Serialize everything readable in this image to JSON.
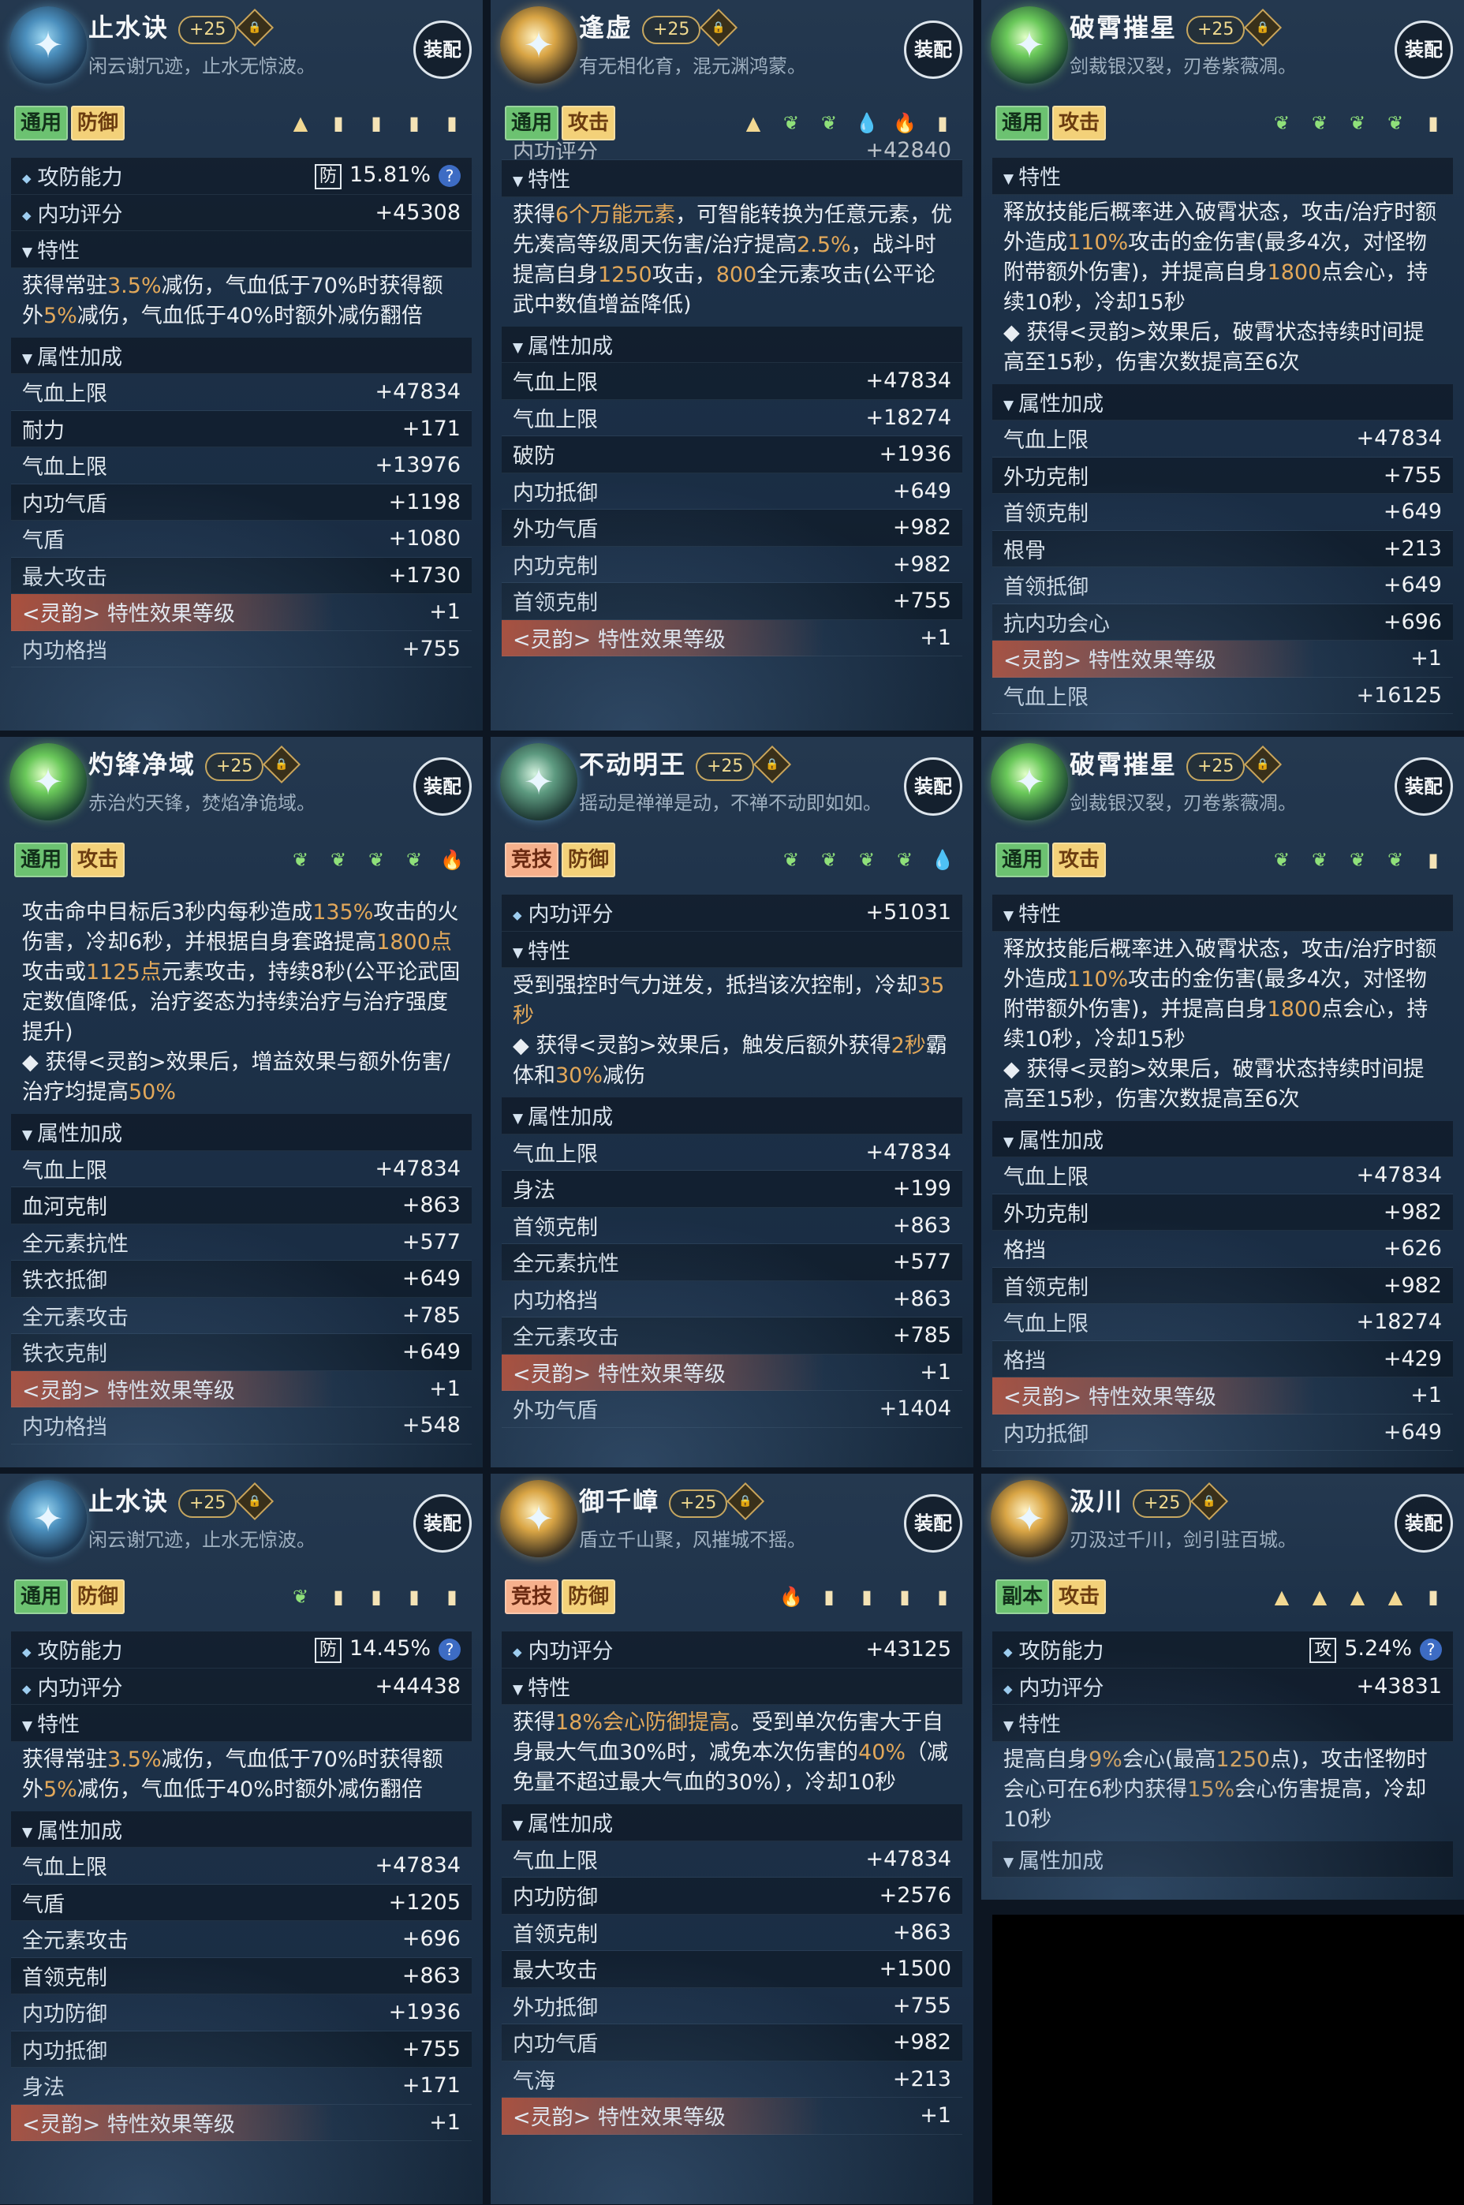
{
  "ui": {
    "equip_label": "装配"
  },
  "cards": [
    {
      "name": "止水诀",
      "level": "+25",
      "desc": "闲云谢冗迹，止水无惊波。",
      "tags": [
        {
          "text": "通用",
          "c": "g"
        },
        {
          "text": "防御",
          "c": "y"
        }
      ],
      "gems": [
        "tri",
        "block",
        "block",
        "block",
        "block"
      ],
      "rows": [
        {
          "t": "bul",
          "l": "攻防能力",
          "box": "防",
          "r": "15.81%",
          "q": true
        },
        {
          "t": "bul",
          "l": "内功评分",
          "r": "+45308"
        },
        {
          "t": "arr",
          "l": "特性"
        },
        {
          "t": "text",
          "parts": [
            [
              "获得常驻",
              ""
            ],
            [
              "3.5%",
              "h"
            ],
            [
              "减伤，气血低于70%时获得额外",
              ""
            ],
            [
              "5%",
              "h"
            ],
            [
              "减伤，气血低于40%时额外减伤翻倍",
              ""
            ]
          ]
        },
        {
          "t": "arr",
          "l": "属性加成"
        },
        {
          "t": "stat",
          "l": "气血上限",
          "r": "+47834"
        },
        {
          "t": "stat",
          "l": "耐力",
          "r": "+171"
        },
        {
          "t": "stat",
          "l": "气血上限",
          "r": "+13976"
        },
        {
          "t": "stat",
          "l": "内功气盾",
          "r": "+1198"
        },
        {
          "t": "stat",
          "l": "气盾",
          "r": "+1080"
        },
        {
          "t": "stat",
          "l": "最大攻击",
          "r": "+1730"
        },
        {
          "t": "ling",
          "l": "<灵韵> 特性效果等级",
          "r": "+1"
        },
        {
          "t": "stat",
          "l": "内功格挡",
          "r": "+755"
        }
      ]
    },
    {
      "name": "逢虚",
      "level": "+25",
      "desc": "有无相化育，混元渊鸿蒙。",
      "tags": [
        {
          "text": "通用",
          "c": "g"
        },
        {
          "text": "攻击",
          "c": "y"
        }
      ],
      "gems": [
        "tri",
        "leaf",
        "leaf",
        "drop",
        "fire",
        "block"
      ],
      "rows": [
        {
          "t": "stat",
          "l": "内功评分",
          "r": "+42840",
          "cut": true
        },
        {
          "t": "arr",
          "l": "特性"
        },
        {
          "t": "text",
          "parts": [
            [
              "获得",
              ""
            ],
            [
              "6个万能元素",
              "h"
            ],
            [
              "，可智能转换为任意元素，优先凑高等级周天伤害/治疗提高",
              ""
            ],
            [
              "2.5%",
              "h"
            ],
            [
              "，战斗时提高自身",
              ""
            ],
            [
              "1250",
              "h"
            ],
            [
              "攻击，",
              ""
            ],
            [
              "800",
              "h"
            ],
            [
              "全元素攻击(公平论武中数值增益降低)",
              ""
            ]
          ]
        },
        {
          "t": "arr",
          "l": "属性加成"
        },
        {
          "t": "stat",
          "l": "气血上限",
          "r": "+47834"
        },
        {
          "t": "stat",
          "l": "气血上限",
          "r": "+18274"
        },
        {
          "t": "stat",
          "l": "破防",
          "r": "+1936"
        },
        {
          "t": "stat",
          "l": "内功抵御",
          "r": "+649"
        },
        {
          "t": "stat",
          "l": "外功气盾",
          "r": "+982"
        },
        {
          "t": "stat",
          "l": "内功克制",
          "r": "+982"
        },
        {
          "t": "stat",
          "l": "首领克制",
          "r": "+755"
        },
        {
          "t": "ling",
          "l": "<灵韵> 特性效果等级",
          "r": "+1"
        }
      ]
    },
    {
      "name": "破霄摧星",
      "level": "+25",
      "desc": "剑裁银汉裂，刃卷紫薇凋。",
      "tags": [
        {
          "text": "通用",
          "c": "g"
        },
        {
          "text": "攻击",
          "c": "y"
        }
      ],
      "gems": [
        "leaf",
        "leaf",
        "leaf",
        "leaf",
        "block"
      ],
      "rows": [
        {
          "t": "arr",
          "l": "特性"
        },
        {
          "t": "text",
          "parts": [
            [
              "释放技能后概率进入破霄状态，攻击/治疗时额外造成",
              ""
            ],
            [
              "110%",
              "h"
            ],
            [
              "攻击的金伤害(最多4次，对怪物附带额外伤害)，并提高自身",
              ""
            ],
            [
              "1800",
              "h"
            ],
            [
              "点会心，持续10秒，冷却15秒",
              ""
            ],
            [
              "\n◆ 获得<灵韵>效果后，破霄状态持续时间提高至15秒，伤害次数提高至6次",
              ""
            ]
          ]
        },
        {
          "t": "arr",
          "l": "属性加成"
        },
        {
          "t": "stat",
          "l": "气血上限",
          "r": "+47834"
        },
        {
          "t": "stat",
          "l": "外功克制",
          "r": "+755"
        },
        {
          "t": "stat",
          "l": "首领克制",
          "r": "+649"
        },
        {
          "t": "stat",
          "l": "根骨",
          "r": "+213"
        },
        {
          "t": "stat",
          "l": "首领抵御",
          "r": "+649"
        },
        {
          "t": "stat",
          "l": "抗内功会心",
          "r": "+696"
        },
        {
          "t": "ling",
          "l": "<灵韵> 特性效果等级",
          "r": "+1"
        },
        {
          "t": "stat",
          "l": "气血上限",
          "r": "+16125"
        }
      ]
    },
    {
      "name": "灼锋净域",
      "level": "+25",
      "desc": "赤治灼天锋，焚焰净诡域。",
      "tags": [
        {
          "text": "通用",
          "c": "g"
        },
        {
          "text": "攻击",
          "c": "y"
        }
      ],
      "gems": [
        "leaf",
        "leaf",
        "leaf",
        "leaf",
        "fire"
      ],
      "rows": [
        {
          "t": "text",
          "parts": [
            [
              "攻击命中目标后3秒内每秒造成",
              ""
            ],
            [
              "135%",
              "h"
            ],
            [
              "攻击的火伤害，冷却6秒，并根据自身套路提高",
              ""
            ],
            [
              "1800点",
              "h"
            ],
            [
              "攻击或",
              ""
            ],
            [
              "1125点",
              "h"
            ],
            [
              "元素攻击，持续8秒(公平论武固定数值降低，治疗姿态为持续治疗与治疗强度提升)",
              ""
            ],
            [
              "\n◆ 获得<灵韵>效果后，增益效果与额外伤害/治疗均提高",
              ""
            ],
            [
              "50%",
              "h"
            ]
          ]
        },
        {
          "t": "arr",
          "l": "属性加成"
        },
        {
          "t": "stat",
          "l": "气血上限",
          "r": "+47834"
        },
        {
          "t": "stat",
          "l": "血河克制",
          "r": "+863"
        },
        {
          "t": "stat",
          "l": "全元素抗性",
          "r": "+577"
        },
        {
          "t": "stat",
          "l": "铁衣抵御",
          "r": "+649"
        },
        {
          "t": "stat",
          "l": "全元素攻击",
          "r": "+785"
        },
        {
          "t": "stat",
          "l": "铁衣克制",
          "r": "+649"
        },
        {
          "t": "ling",
          "l": "<灵韵> 特性效果等级",
          "r": "+1"
        },
        {
          "t": "stat",
          "l": "内功格挡",
          "r": "+548"
        }
      ]
    },
    {
      "name": "不动明王",
      "level": "+25",
      "desc": "摇动是禅禅是动，不禅不动即如如。",
      "tags": [
        {
          "text": "竞技",
          "c": "o"
        },
        {
          "text": "防御",
          "c": "y"
        }
      ],
      "gems": [
        "leaf",
        "leaf",
        "leaf",
        "leaf",
        "drop"
      ],
      "rows": [
        {
          "t": "bul",
          "l": "内功评分",
          "r": "+51031"
        },
        {
          "t": "arr",
          "l": "特性"
        },
        {
          "t": "text",
          "parts": [
            [
              "受到强控时气力迸发，抵挡该次控制，冷却",
              ""
            ],
            [
              "35秒",
              "h"
            ],
            [
              "\n◆ 获得<灵韵>效果后，触发后额外获得",
              ""
            ],
            [
              "2秒",
              "h"
            ],
            [
              "霸体和",
              ""
            ],
            [
              "30%",
              "h"
            ],
            [
              "减伤",
              ""
            ]
          ]
        },
        {
          "t": "arr",
          "l": "属性加成"
        },
        {
          "t": "stat",
          "l": "气血上限",
          "r": "+47834"
        },
        {
          "t": "stat",
          "l": "身法",
          "r": "+199"
        },
        {
          "t": "stat",
          "l": "首领克制",
          "r": "+863"
        },
        {
          "t": "stat",
          "l": "全元素抗性",
          "r": "+577"
        },
        {
          "t": "stat",
          "l": "内功格挡",
          "r": "+863"
        },
        {
          "t": "stat",
          "l": "全元素攻击",
          "r": "+785"
        },
        {
          "t": "ling",
          "l": "<灵韵> 特性效果等级",
          "r": "+1"
        },
        {
          "t": "stat",
          "l": "外功气盾",
          "r": "+1404"
        }
      ]
    },
    {
      "name": "破霄摧星",
      "level": "+25",
      "desc": "剑裁银汉裂，刃卷紫薇凋。",
      "tags": [
        {
          "text": "通用",
          "c": "g"
        },
        {
          "text": "攻击",
          "c": "y"
        }
      ],
      "gems": [
        "leaf",
        "leaf",
        "leaf",
        "leaf",
        "block"
      ],
      "rows": [
        {
          "t": "arr",
          "l": "特性"
        },
        {
          "t": "text",
          "parts": [
            [
              "释放技能后概率进入破霄状态，攻击/治疗时额外造成",
              ""
            ],
            [
              "110%",
              "h"
            ],
            [
              "攻击的金伤害(最多4次，对怪物附带额外伤害)，并提高自身",
              ""
            ],
            [
              "1800",
              "h"
            ],
            [
              "点会心，持续10秒，冷却15秒",
              ""
            ],
            [
              "\n◆ 获得<灵韵>效果后，破霄状态持续时间提高至15秒，伤害次数提高至6次",
              ""
            ]
          ]
        },
        {
          "t": "arr",
          "l": "属性加成"
        },
        {
          "t": "stat",
          "l": "气血上限",
          "r": "+47834"
        },
        {
          "t": "stat",
          "l": "外功克制",
          "r": "+982"
        },
        {
          "t": "stat",
          "l": "格挡",
          "r": "+626"
        },
        {
          "t": "stat",
          "l": "首领克制",
          "r": "+982"
        },
        {
          "t": "stat",
          "l": "气血上限",
          "r": "+18274"
        },
        {
          "t": "stat",
          "l": "格挡",
          "r": "+429"
        },
        {
          "t": "ling",
          "l": "<灵韵> 特性效果等级",
          "r": "+1"
        },
        {
          "t": "stat",
          "l": "内功抵御",
          "r": "+649"
        }
      ]
    },
    {
      "name": "止水诀",
      "level": "+25",
      "desc": "闲云谢冗迹，止水无惊波。",
      "tags": [
        {
          "text": "通用",
          "c": "g"
        },
        {
          "text": "防御",
          "c": "y"
        }
      ],
      "gems": [
        "leaf",
        "block",
        "block",
        "block",
        "block"
      ],
      "rows": [
        {
          "t": "bul",
          "l": "攻防能力",
          "box": "防",
          "r": "14.45%",
          "q": true
        },
        {
          "t": "bul",
          "l": "内功评分",
          "r": "+44438"
        },
        {
          "t": "arr",
          "l": "特性"
        },
        {
          "t": "text",
          "parts": [
            [
              "获得常驻",
              ""
            ],
            [
              "3.5%",
              "h"
            ],
            [
              "减伤，气血低于70%时获得额外",
              ""
            ],
            [
              "5%",
              "h"
            ],
            [
              "减伤，气血低于40%时额外减伤翻倍",
              ""
            ]
          ]
        },
        {
          "t": "arr",
          "l": "属性加成"
        },
        {
          "t": "stat",
          "l": "气血上限",
          "r": "+47834"
        },
        {
          "t": "stat",
          "l": "气盾",
          "r": "+1205"
        },
        {
          "t": "stat",
          "l": "全元素攻击",
          "r": "+696"
        },
        {
          "t": "stat",
          "l": "首领克制",
          "r": "+863"
        },
        {
          "t": "stat",
          "l": "内功防御",
          "r": "+1936"
        },
        {
          "t": "stat",
          "l": "内功抵御",
          "r": "+755"
        },
        {
          "t": "stat",
          "l": "身法",
          "r": "+171"
        },
        {
          "t": "ling",
          "l": "<灵韵> 特性效果等级",
          "r": "+1"
        }
      ]
    },
    {
      "name": "御千嶂",
      "level": "+25",
      "desc": "盾立千山聚，风摧城不摇。",
      "tags": [
        {
          "text": "竞技",
          "c": "o"
        },
        {
          "text": "防御",
          "c": "y"
        }
      ],
      "gems": [
        "fire",
        "block",
        "block",
        "block",
        "block"
      ],
      "rows": [
        {
          "t": "bul",
          "l": "内功评分",
          "r": "+43125"
        },
        {
          "t": "arr",
          "l": "特性"
        },
        {
          "t": "text",
          "parts": [
            [
              "获得",
              ""
            ],
            [
              "18%会心防御提高",
              "h"
            ],
            [
              "。受到单次伤害大于自身最大气血30%时，减免本次伤害的",
              ""
            ],
            [
              "40%",
              "h"
            ],
            [
              "（减免量不超过最大气血的30%），冷却10秒",
              ""
            ]
          ]
        },
        {
          "t": "arr",
          "l": "属性加成"
        },
        {
          "t": "stat",
          "l": "气血上限",
          "r": "+47834"
        },
        {
          "t": "stat",
          "l": "内功防御",
          "r": "+2576"
        },
        {
          "t": "stat",
          "l": "首领克制",
          "r": "+863"
        },
        {
          "t": "stat",
          "l": "最大攻击",
          "r": "+1500"
        },
        {
          "t": "stat",
          "l": "外功抵御",
          "r": "+755"
        },
        {
          "t": "stat",
          "l": "内功气盾",
          "r": "+982"
        },
        {
          "t": "stat",
          "l": "气海",
          "r": "+213"
        },
        {
          "t": "ling",
          "l": "<灵韵> 特性效果等级",
          "r": "+1"
        }
      ]
    },
    {
      "name": "汲川",
      "level": "+25",
      "desc": "刃汲过千川，剑引驻百城。",
      "tags": [
        {
          "text": "副本",
          "c": "g"
        },
        {
          "text": "攻击",
          "c": "y"
        }
      ],
      "gems": [
        "tri",
        "tri",
        "tri",
        "tri",
        "block"
      ],
      "rows": [
        {
          "t": "bul",
          "l": "攻防能力",
          "box": "攻",
          "r": "5.24%",
          "q": true
        },
        {
          "t": "bul",
          "l": "内功评分",
          "r": "+43831"
        },
        {
          "t": "arr",
          "l": "特性"
        },
        {
          "t": "text",
          "parts": [
            [
              "提高自身",
              ""
            ],
            [
              "9%",
              "h"
            ],
            [
              "会心(最高",
              ""
            ],
            [
              "1250",
              "h"
            ],
            [
              "点)，攻击怪物时会心可在6秒内获得",
              ""
            ],
            [
              "15%",
              "h"
            ],
            [
              "会心伤害提高，冷却10秒",
              ""
            ]
          ]
        },
        {
          "t": "arr",
          "l": "属性加成"
        }
      ]
    }
  ]
}
